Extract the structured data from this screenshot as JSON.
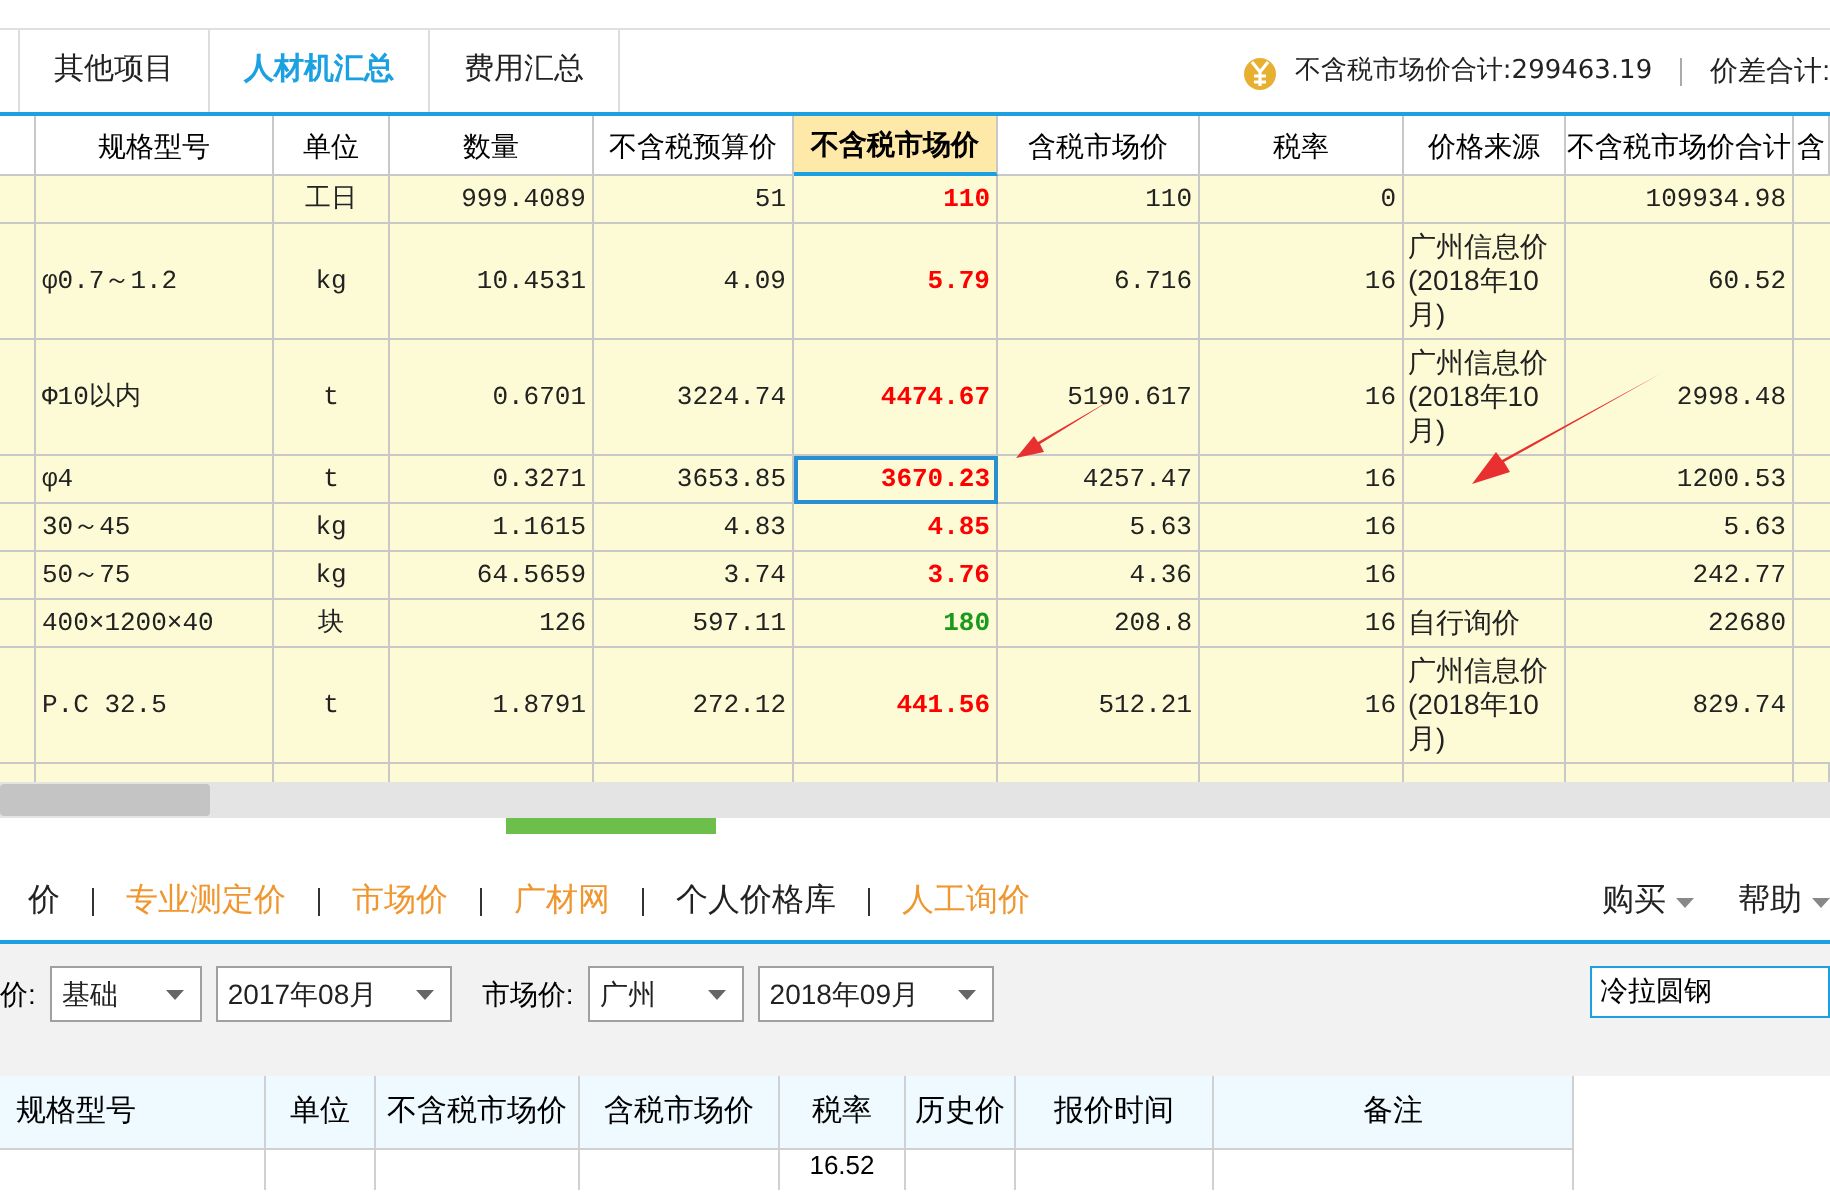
{
  "tabs": [
    {
      "label": "其他项目",
      "selected": false
    },
    {
      "label": "人材机汇总",
      "selected": true
    },
    {
      "label": "费用汇总",
      "selected": false
    }
  ],
  "summary": {
    "total": "不含税市场价合计:299463.19",
    "diff": "价差合计:"
  },
  "table": {
    "columns": [
      {
        "label": "规格型号",
        "selected": false
      },
      {
        "label": "单位",
        "selected": false
      },
      {
        "label": "数量",
        "selected": false
      },
      {
        "label": "不含税预算价",
        "selected": false
      },
      {
        "label": "不含税市场价",
        "selected": true
      },
      {
        "label": "含税市场价",
        "selected": false
      },
      {
        "label": "税率",
        "selected": false
      },
      {
        "label": "价格来源",
        "selected": false
      },
      {
        "label": "不含税市场价合计",
        "selected": false
      },
      {
        "label": "含",
        "selected": false
      }
    ],
    "rows": [
      {
        "spec": "",
        "unit": "工日",
        "qty": "999.4089",
        "budget": "51",
        "market": "110",
        "color": "#ff0000",
        "tax_market": "110",
        "rate": "0",
        "source": "",
        "total": "109934.98",
        "selected": false
      },
      {
        "spec": "φ0.7～1.2",
        "unit": "kg",
        "qty": "10.4531",
        "budget": "4.09",
        "market": "5.79",
        "color": "#ff0000",
        "tax_market": "6.716",
        "rate": "16",
        "source": "广州信息价(2018年10月)",
        "total": "60.52",
        "selected": false
      },
      {
        "spec": "Φ10以内",
        "unit": "t",
        "qty": "0.6701",
        "budget": "3224.74",
        "market": "4474.67",
        "color": "#ff0000",
        "tax_market": "5190.617",
        "rate": "16",
        "source": "广州信息价(2018年10月)",
        "total": "2998.48",
        "selected": false
      },
      {
        "spec": "φ4",
        "unit": "t",
        "qty": "0.3271",
        "budget": "3653.85",
        "market": "3670.23",
        "color": "#ff0000",
        "tax_market": "4257.47",
        "rate": "16",
        "source": "",
        "total": "1200.53",
        "selected": true
      },
      {
        "spec": "30～45",
        "unit": "kg",
        "qty": "1.1615",
        "budget": "4.83",
        "market": "4.85",
        "color": "#ff0000",
        "tax_market": "5.63",
        "rate": "16",
        "source": "",
        "total": "5.63",
        "selected": false
      },
      {
        "spec": "50～75",
        "unit": "kg",
        "qty": "64.5659",
        "budget": "3.74",
        "market": "3.76",
        "color": "#ff0000",
        "tax_market": "4.36",
        "rate": "16",
        "source": "",
        "total": "242.77",
        "selected": false
      },
      {
        "spec": "400×1200×40",
        "unit": "块",
        "qty": "126",
        "budget": "597.11",
        "market": "180",
        "color": "#1a9a1a",
        "tax_market": "208.8",
        "rate": "16",
        "source": "自行询价",
        "total": "22680",
        "selected": false
      },
      {
        "spec": "P.C 32.5",
        "unit": "t",
        "qty": "1.8791",
        "budget": "272.12",
        "market": "441.56",
        "color": "#ff0000",
        "tax_market": "512.21",
        "rate": "16",
        "source": "广州信息价(2018年10月)",
        "total": "829.74",
        "selected": false
      }
    ]
  },
  "links": [
    {
      "label": "价",
      "kind": "plain"
    },
    {
      "label": "专业测定价",
      "kind": "orange"
    },
    {
      "label": "市场价",
      "kind": "orange"
    },
    {
      "label": "广材网",
      "kind": "orange"
    },
    {
      "label": "个人价格库",
      "kind": "plain"
    },
    {
      "label": "人工询价",
      "kind": "orange"
    }
  ],
  "menus": [
    "购买",
    "帮助"
  ],
  "filters": {
    "label1": "价:",
    "base": "基础",
    "base_date": "2017年08月",
    "label2": "市场价:",
    "city": "广州",
    "market_date": "2018年09月",
    "search": "冷拉圆钢"
  },
  "lower_table": {
    "columns": [
      "规格型号",
      "单位",
      "不含税市场价",
      "含税市场价",
      "税率",
      "历史价",
      "报价时间",
      "备注"
    ],
    "partial_rate": "16.52"
  }
}
